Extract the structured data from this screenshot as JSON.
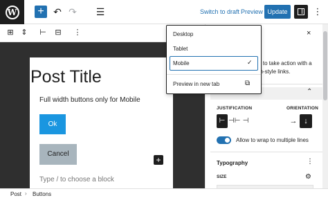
{
  "header": {
    "logo_glyph": "W",
    "inserter_glyph": "+",
    "list_view_glyph": "☰",
    "undo_glyph": "↶",
    "redo_glyph": "↷",
    "switch_to_draft": "Switch to draft",
    "preview": "Preview",
    "update": "Update",
    "more_glyph": "⋮"
  },
  "block_toolbar": {
    "parent_glyph": "⊞",
    "move_glyph": "⇕",
    "justify_left_glyph": "⊢",
    "justify_center_glyph": "⊟",
    "more_glyph": "⋮"
  },
  "canvas": {
    "post_title": "Post Title",
    "paragraph": "Full width buttons only for Mobile",
    "button_ok": "Ok",
    "button_cancel": "Cancel",
    "add_block_glyph": "+",
    "placeholder": "Type / to choose a block"
  },
  "breadcrumb": {
    "items": [
      "Post",
      "Buttons"
    ],
    "separator": "›"
  },
  "preview_menu": {
    "items": [
      "Desktop",
      "Tablet",
      "Mobile"
    ],
    "selected": "Mobile",
    "check_glyph": "✓",
    "preview_new_tab": "Preview in new tab",
    "external_glyph": "⧉"
  },
  "sidebar": {
    "close_glyph": "×",
    "description_line1": "rs to take action with a",
    "description_line2": "on-style links.",
    "panel_chevron": "⌃",
    "justification_label": "JUSTIFICATION",
    "orientation_label": "ORIENTATION",
    "justify_glyphs": [
      "⊢",
      "⊣⊢",
      "⊣"
    ],
    "orientation_horizontal_glyph": "→",
    "orientation_vertical_glyph": "↓",
    "wrap_toggle_label": "Allow to wrap to multiple lines",
    "wrap_toggle_on": true,
    "typography_title": "Typography",
    "typography_more_glyph": "⋮",
    "size_label": "SIZE",
    "size_settings_glyph": "⚙"
  },
  "colors": {
    "accent": "#2271b1",
    "button_ok_bg": "#1a96e0",
    "button_cancel_bg": "#a8b5bd",
    "canvas_bg": "#2f2f2f"
  }
}
